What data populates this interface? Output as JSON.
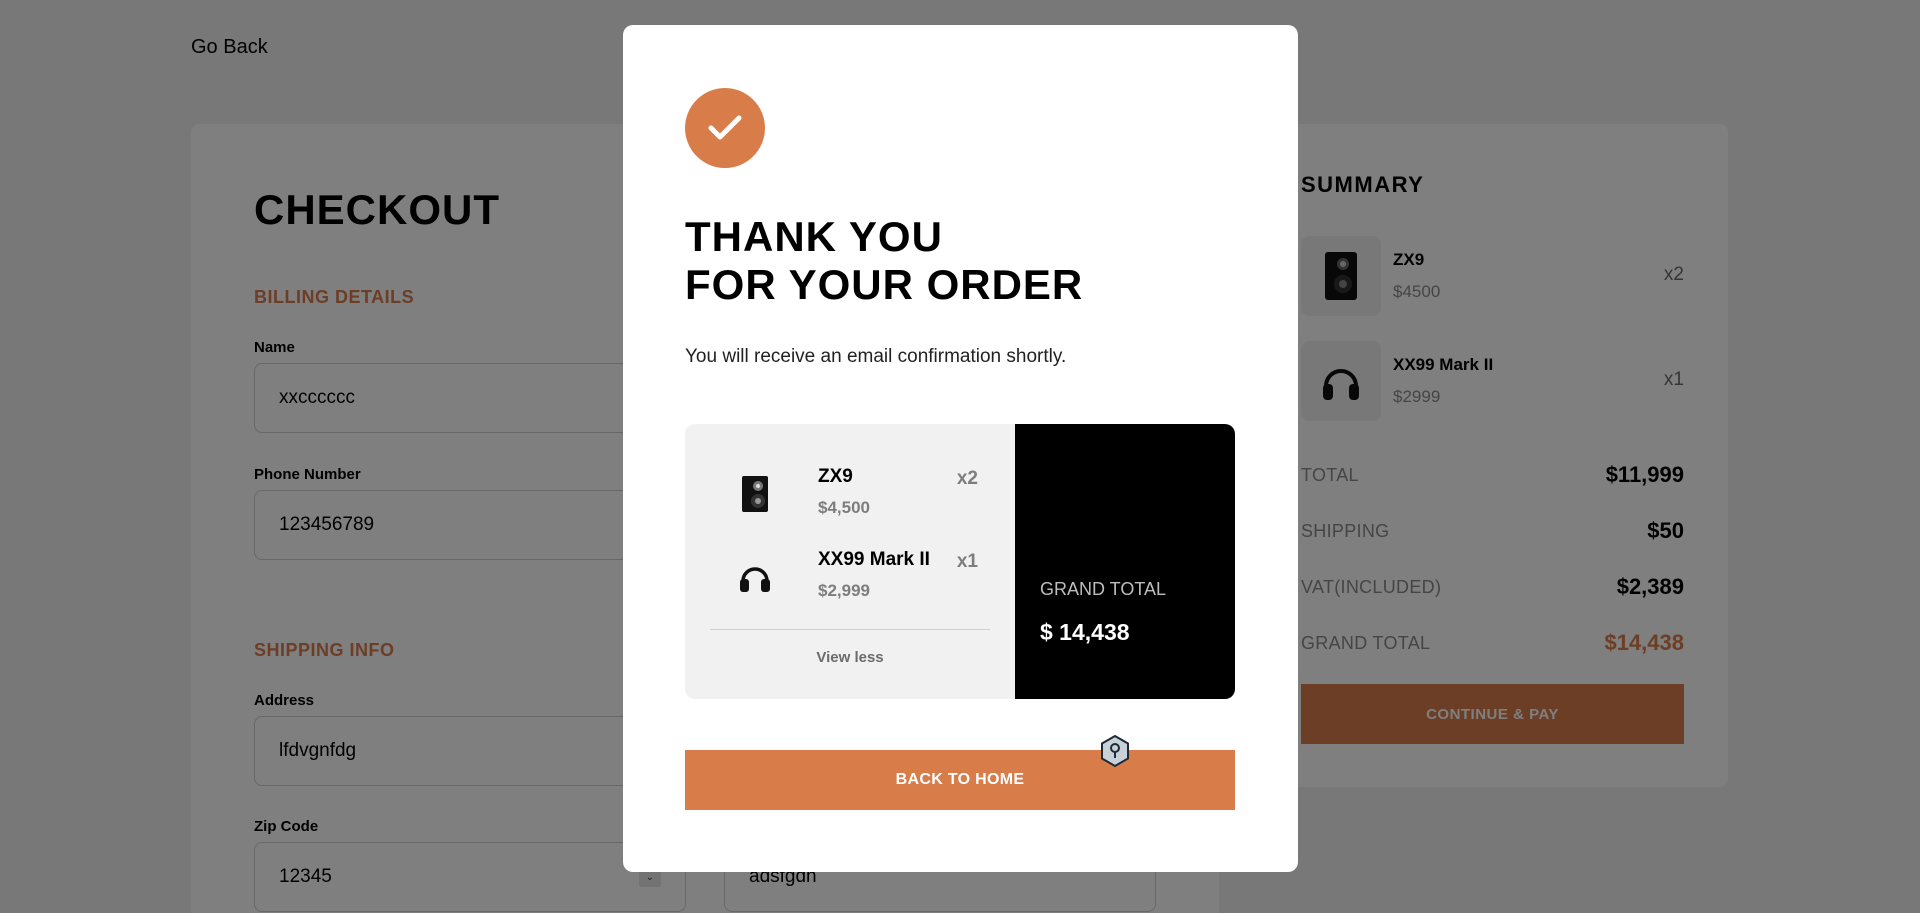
{
  "page": {
    "go_back": "Go Back",
    "checkout_title": "CHECKOUT",
    "billing_title": "BILLING DETAILS",
    "name_label": "Name",
    "name_value": "xxcccccc",
    "phone_label": "Phone Number",
    "phone_value": "123456789",
    "shipping_title": "SHIPPING INFO",
    "address_label": "Address",
    "address_value": "lfdvgnfdg",
    "zip_label": "Zip Code",
    "zip_value": "12345",
    "city_value": "adsfgdh"
  },
  "summary": {
    "title": "SUMMARY",
    "items": [
      {
        "name": "ZX9",
        "price": "$4500",
        "qty": "x2"
      },
      {
        "name": "XX99 Mark II",
        "price": "$2999",
        "qty": "x1"
      }
    ],
    "total_label": "TOTAL",
    "total_value": "$11,999",
    "shipping_label": "SHIPPING",
    "shipping_value": "$50",
    "vat_label": "VAT(INCLUDED)",
    "vat_value": "$2,389",
    "grand_label": "GRAND TOTAL",
    "grand_value": "$14,438",
    "continue_label": "CONTINUE & PAY"
  },
  "modal": {
    "title_line1": "THANK YOU",
    "title_line2": "FOR YOUR ORDER",
    "subtitle": "You will receive an email confirmation shortly.",
    "items": [
      {
        "name": "ZX9",
        "price": "$4,500",
        "qty": "x2"
      },
      {
        "name": "XX99 Mark II",
        "price": "$2,999",
        "qty": "x1"
      }
    ],
    "view_less": "View less",
    "grand_total_label": "GRAND TOTAL",
    "grand_total_value": "$ 14,438",
    "back_home_label": "BACK TO HOME"
  },
  "colors": {
    "accent": "#d87d4a",
    "dark": "#000000",
    "light_bg": "#f1f1f1"
  }
}
